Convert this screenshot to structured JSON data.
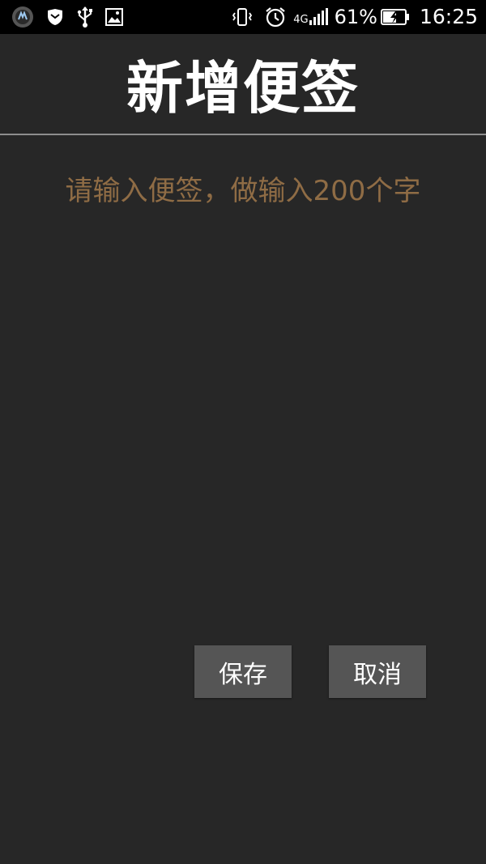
{
  "status_bar": {
    "left_icons": [
      "app-logo-icon",
      "shield-icon",
      "usb-icon",
      "image-icon"
    ],
    "right_icons": [
      "vibrate-icon",
      "alarm-icon",
      "signal-icon",
      "battery-charging-icon"
    ],
    "network_label": "4G",
    "battery_percent": "61%",
    "time": "16:25"
  },
  "header": {
    "title": "新增便签"
  },
  "note": {
    "placeholder": "请输入便签，做输入200个字",
    "value": ""
  },
  "buttons": {
    "save_label": "保存",
    "cancel_label": "取消"
  },
  "colors": {
    "background": "#272727",
    "placeholder": "#8f6c45",
    "button_bg": "#555555",
    "divider": "#8e8e8e"
  }
}
